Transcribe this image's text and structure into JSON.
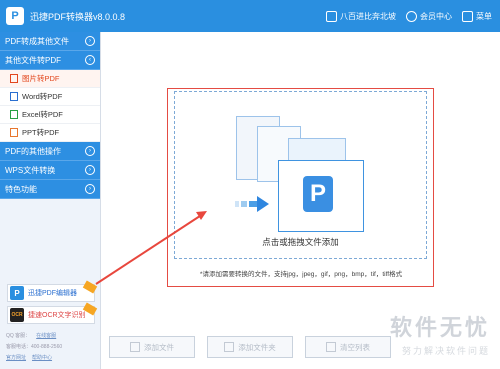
{
  "window": {
    "title": "迅捷PDF转换器v8.0.0.8",
    "logo_glyph": "P",
    "accent": "#2a8fe0"
  },
  "titlebar": {
    "bookmark_label": "八百进比奔北坡",
    "member_label": "会员中心",
    "menu_label": "菜单"
  },
  "sidebar": {
    "categories": [
      {
        "label": "PDF转成其他文件",
        "arrow": "›"
      },
      {
        "label": "其他文件转PDF",
        "arrow": "‹"
      },
      {
        "label": "PDF的其他操作",
        "arrow": "›"
      },
      {
        "label": "WPS文件转换",
        "arrow": "›"
      },
      {
        "label": "特色功能",
        "arrow": "›"
      }
    ],
    "subitems": [
      {
        "label": "图片转PDF",
        "active": true,
        "icon": "image-icon"
      },
      {
        "label": "Word转PDF",
        "icon": "word-icon"
      },
      {
        "label": "Excel转PDF",
        "icon": "excel-icon"
      },
      {
        "label": "PPT转PDF",
        "icon": "ppt-icon"
      }
    ],
    "promos": [
      {
        "label": "迅捷PDF编辑器",
        "glyph": "P"
      },
      {
        "label": "捷速OCR文字识别",
        "glyph": "OCR"
      }
    ],
    "footer": {
      "qq_label": "QQ 客服：",
      "qq_link": "在线客服",
      "phone_label": "客服电话：400-888-2560",
      "site_label": "官方网址",
      "help_link": "帮助中心"
    }
  },
  "main": {
    "drop_label": "点击或拖拽文件添加",
    "hint": "*请添加需要转换的文件，支持jpg，jpeg，gif，png，bmp，tif，tiff格式",
    "buttons": [
      {
        "label": "添加文件"
      },
      {
        "label": "添加文件夹"
      },
      {
        "label": "清空列表"
      }
    ]
  },
  "watermark": {
    "title": "软件无忧",
    "subtitle": "努力解决软件问题"
  }
}
